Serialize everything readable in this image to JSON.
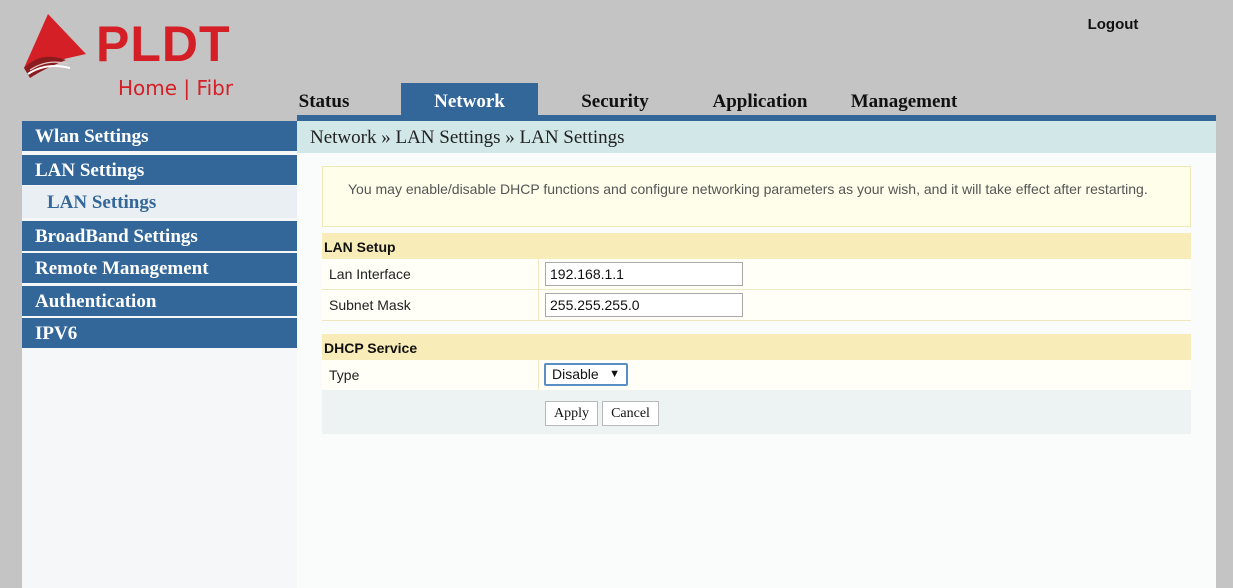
{
  "brand": {
    "name": "PLDT",
    "tagline": "Home | Fibr",
    "colors": {
      "red": "#d41f26",
      "blue": "#336699"
    }
  },
  "header": {
    "logout_label": "Logout"
  },
  "tabs": [
    {
      "label": "Status",
      "active": false
    },
    {
      "label": "Network",
      "active": true
    },
    {
      "label": "Security",
      "active": false
    },
    {
      "label": "Application",
      "active": false
    },
    {
      "label": "Management",
      "active": false
    }
  ],
  "sidebar": {
    "items": [
      {
        "label": "Wlan Settings"
      },
      {
        "label": "LAN Settings"
      },
      {
        "label": "LAN Settings",
        "sub": true,
        "selected": true
      },
      {
        "label": "BroadBand Settings"
      },
      {
        "label": "Remote Management"
      },
      {
        "label": "Authentication"
      },
      {
        "label": "IPV6"
      }
    ]
  },
  "main": {
    "breadcrumb": "Network » LAN Settings » LAN Settings",
    "notice": "You may enable/disable DHCP functions and configure networking parameters as your wish, and it will take effect after restarting.",
    "lan_setup": {
      "title": "LAN Setup",
      "lan_interface_label": "Lan Interface",
      "lan_interface_value": "192.168.1.1",
      "subnet_mask_label": "Subnet Mask",
      "subnet_mask_value": "255.255.255.0"
    },
    "dhcp": {
      "title": "DHCP Service",
      "type_label": "Type",
      "type_value": "Disable",
      "arrow": "▼"
    },
    "buttons": {
      "apply": "Apply",
      "cancel": "Cancel"
    }
  }
}
